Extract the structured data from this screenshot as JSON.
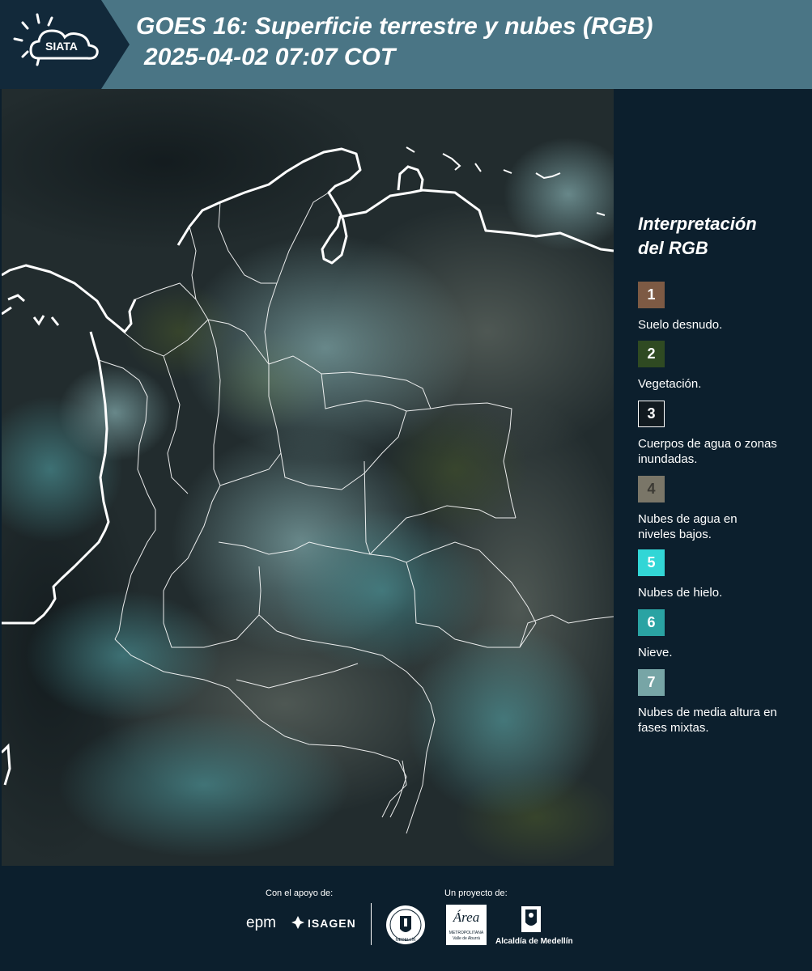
{
  "header": {
    "logo_text": "SIATA",
    "title_line1": "GOES 16: Superficie terrestre y nubes (RGB)",
    "title_line2": "2025-04-02 07:07 COT"
  },
  "legend": {
    "title_line1": "Interpretación",
    "title_line2": "del RGB",
    "items": [
      {
        "number": "1",
        "label": "Suelo desnudo.",
        "color": "#7d5a44"
      },
      {
        "number": "2",
        "label": "Vegetación.",
        "color": "#2f4a22"
      },
      {
        "number": "3",
        "label": "Cuerpos de agua o zonas inundadas.",
        "color": "#111a20"
      },
      {
        "number": "4",
        "label": "Nubes de agua en niveles bajos.",
        "color": "#7a7668"
      },
      {
        "number": "5",
        "label": "Nubes de hielo.",
        "color": "#32d6d6"
      },
      {
        "number": "6",
        "label": "Nieve.",
        "color": "#2aa3a3"
      },
      {
        "number": "7",
        "label": "Nubes de media altura en fases mixtas.",
        "color": "#77a5a6"
      }
    ]
  },
  "footer": {
    "support_label": "Con el apoyo de:",
    "project_label": "Un proyecto de:",
    "sponsor_epm": "epm",
    "sponsor_isagen": "ISAGEN",
    "sponsor_metro_main": "Área",
    "sponsor_metro_sub1": "METROPOLITANA",
    "sponsor_metro_sub2": "Valle de Aburrá",
    "sponsor_medellin": "Alcaldía de Medellín",
    "seal_text": "MEDELLÍN"
  },
  "map": {
    "region": "Colombia",
    "border_color": "#ffffff"
  }
}
